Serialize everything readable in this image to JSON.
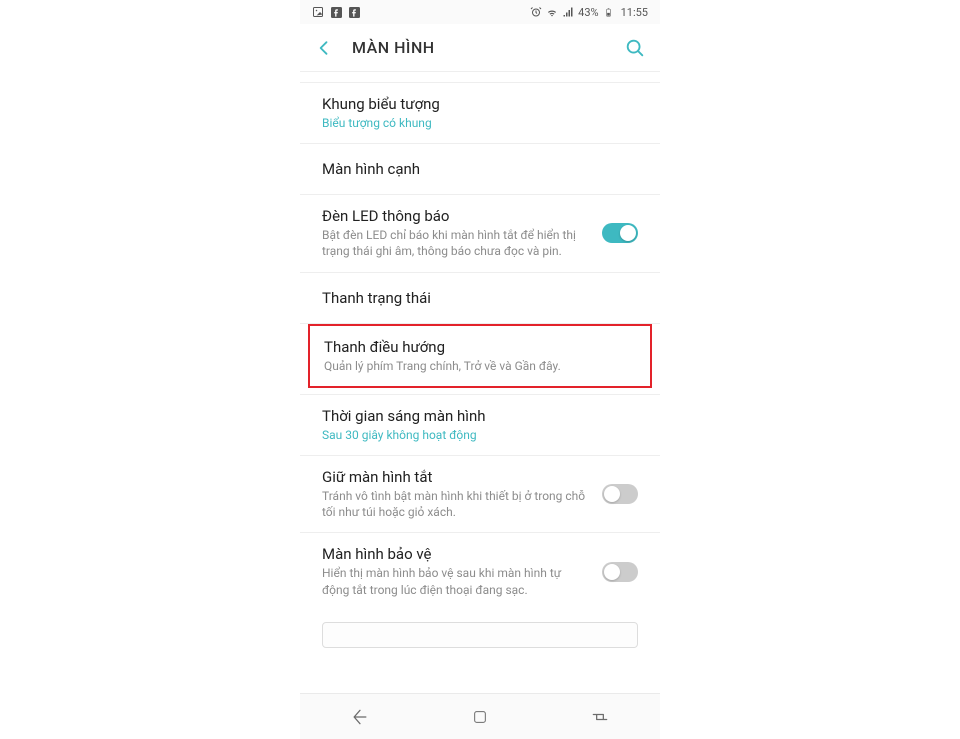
{
  "status_bar": {
    "battery_pct": "43%",
    "time": "11:55"
  },
  "header": {
    "title": "MÀN HÌNH"
  },
  "items": {
    "truncated_top": "",
    "icon_frame": {
      "title": "Khung biểu tượng",
      "subtitle": "Biểu tượng có khung"
    },
    "edge_screen": {
      "title": "Màn hình cạnh"
    },
    "led_indicator": {
      "title": "Đèn LED thông báo",
      "subtitle": "Bật đèn LED chỉ báo khi màn hình tắt để hiển thị trạng thái ghi âm, thông báo chưa đọc và pin."
    },
    "status_bar_section": {
      "title": "Thanh trạng thái"
    },
    "nav_bar": {
      "title": "Thanh điều hướng",
      "subtitle": "Quản lý phím Trang chính, Trở về và Gần đây."
    },
    "screen_timeout": {
      "title": "Thời gian sáng màn hình",
      "subtitle": "Sau 30 giây không hoạt động"
    },
    "keep_screen_off": {
      "title": "Giữ màn hình tắt",
      "subtitle": "Tránh vô tình bật màn hình khi thiết bị ở trong chỗ tối như túi hoặc giỏ xách."
    },
    "screen_saver": {
      "title": "Màn hình bảo vệ",
      "subtitle": "Hiển thị màn hình bảo vệ sau khi màn hình tự động tắt trong lúc điện thoại đang sạc."
    }
  }
}
